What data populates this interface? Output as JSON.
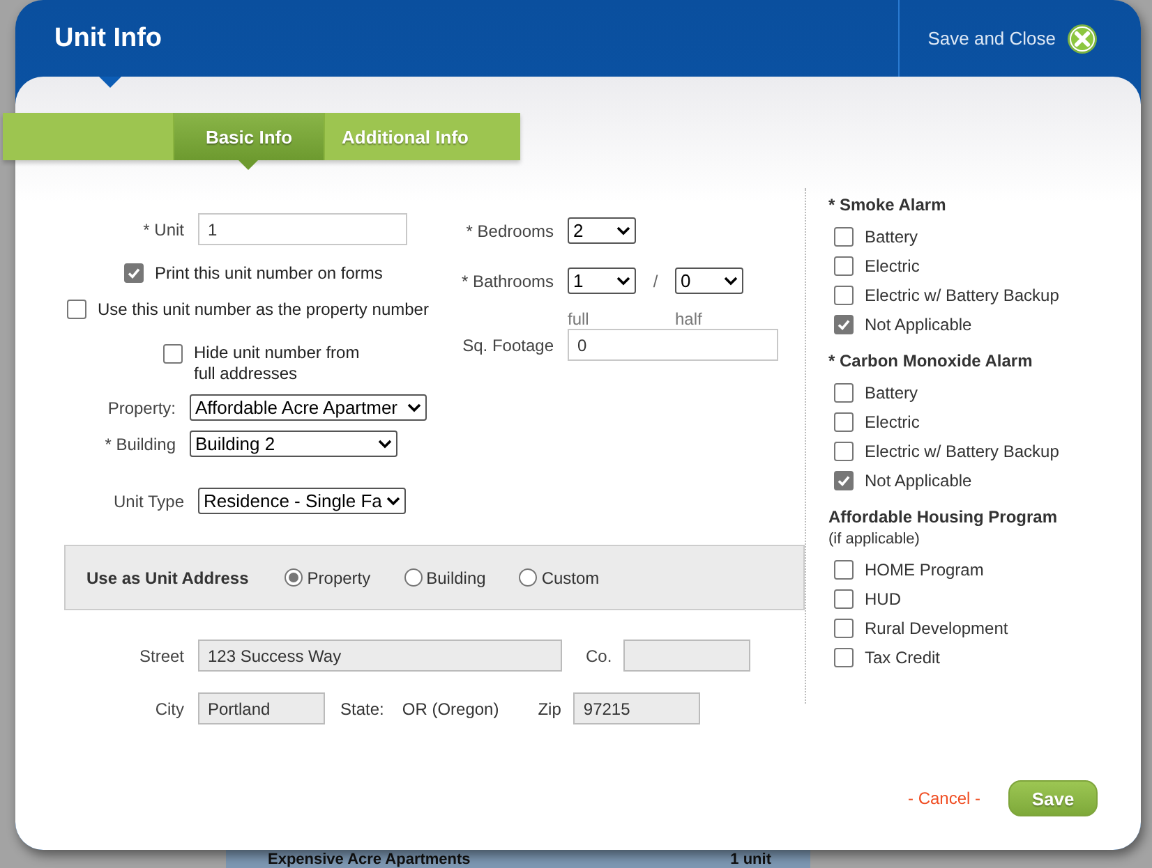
{
  "window": {
    "title": "Unit Info",
    "save_close": "Save and Close"
  },
  "tabs": [
    {
      "label": "Basic Info",
      "selected": true
    },
    {
      "label": "Additional Info",
      "selected": false
    }
  ],
  "unit": {
    "label": "* Unit",
    "value": "1"
  },
  "options": [
    {
      "label": "Print this unit number on forms",
      "checked": true
    },
    {
      "label": "Use this unit number as the property number",
      "checked": false
    },
    {
      "label": "Hide unit number from full addresses",
      "checked": false
    }
  ],
  "property": {
    "label": "Property:",
    "value": "Affordable Acre Apartmer"
  },
  "building": {
    "label": "* Building",
    "value": "Building 2"
  },
  "unit_type": {
    "label": "Unit Type",
    "value": "Residence - Single Fa"
  },
  "bedrooms": {
    "label": "* Bedrooms",
    "value": "2"
  },
  "bathrooms": {
    "label": "* Bathrooms",
    "full": "1",
    "separator": "/",
    "half": "0",
    "full_caption": "full",
    "half_caption": "half"
  },
  "sq_footage": {
    "label": "Sq. Footage",
    "value": "0"
  },
  "unit_address": {
    "label": "Use as Unit Address",
    "choices": [
      {
        "label": "Property",
        "selected": true
      },
      {
        "label": "Building",
        "selected": false
      },
      {
        "label": "Custom",
        "selected": false
      }
    ]
  },
  "address": {
    "street": {
      "label": "Street",
      "value": "123 Success Way"
    },
    "county": {
      "label": "Co."
    },
    "city": {
      "label": "City",
      "value": "Portland"
    },
    "state": {
      "label": "State:",
      "value": "OR (Oregon)"
    },
    "zip": {
      "label": "Zip",
      "value": "97215"
    }
  },
  "checklists": [
    {
      "title": "* Smoke Alarm",
      "items": [
        {
          "label": "Battery",
          "checked": false
        },
        {
          "label": "Electric",
          "checked": false
        },
        {
          "label": "Electric w/ Battery Backup",
          "checked": false
        },
        {
          "label": "Not Applicable",
          "checked": true
        }
      ]
    },
    {
      "title": "* Carbon Monoxide Alarm",
      "items": [
        {
          "label": "Battery",
          "checked": false
        },
        {
          "label": "Electric",
          "checked": false
        },
        {
          "label": "Electric w/ Battery Backup",
          "checked": false
        },
        {
          "label": "Not Applicable",
          "checked": true
        }
      ]
    },
    {
      "title": "Affordable Housing Program",
      "note": "(if applicable)",
      "items": [
        {
          "label": "HOME Program",
          "checked": false
        },
        {
          "label": "HUD",
          "checked": false
        },
        {
          "label": "Rural Development",
          "checked": false
        },
        {
          "label": "Tax Credit",
          "checked": false
        }
      ]
    }
  ],
  "footer": {
    "cancel": "- Cancel -",
    "save": "Save"
  },
  "background": {
    "bottom_row": [
      "Expensive Acre Apartments",
      "1 unit"
    ]
  }
}
